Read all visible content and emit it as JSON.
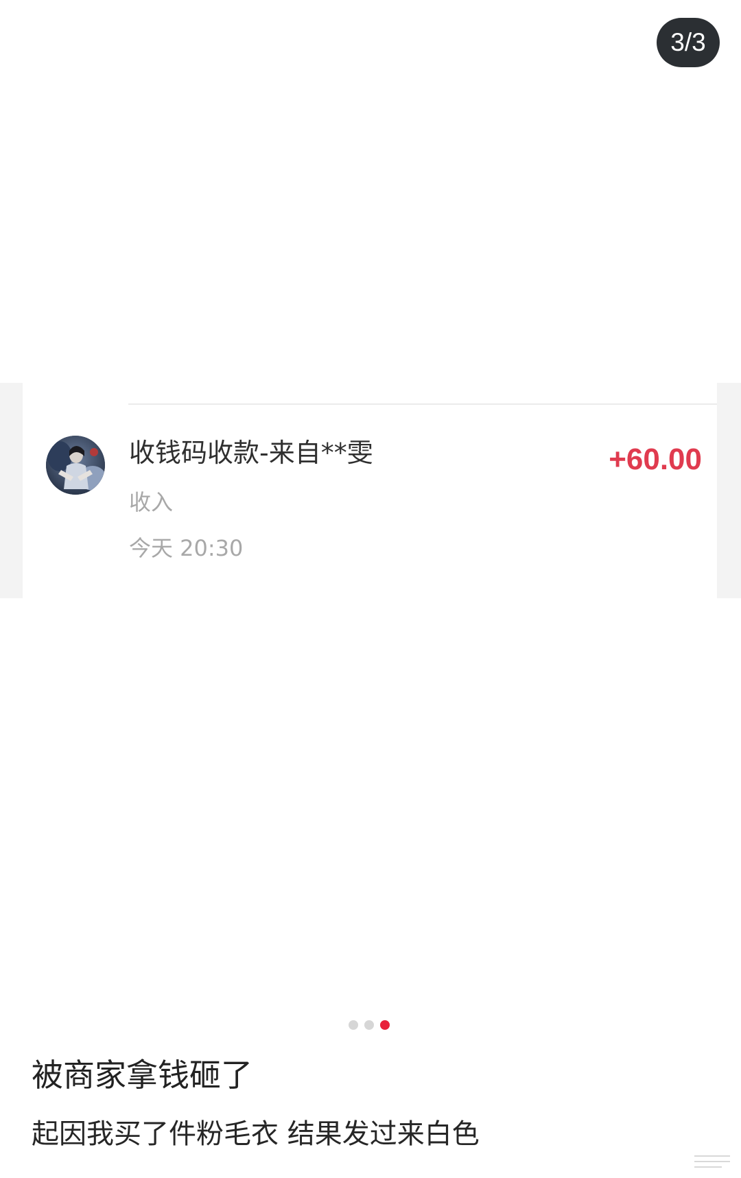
{
  "viewer": {
    "counter": "3/3"
  },
  "transaction": {
    "title": "收钱码收款-来自**雯",
    "amount": "+60.00",
    "type": "收入",
    "time": "今天 20:30",
    "avatar_icon": "user-photo-avatar",
    "amount_color": "#e03b4f"
  },
  "pagination": {
    "total": 3,
    "active_index": 2,
    "active_color": "#e8213b"
  },
  "post": {
    "title": "被商家拿钱砸了",
    "body": "起因我买了件粉毛衣 结果发过来白色"
  },
  "colors": {
    "counter_bg": "#2b2f33",
    "band_bg": "#f3f3f3"
  }
}
